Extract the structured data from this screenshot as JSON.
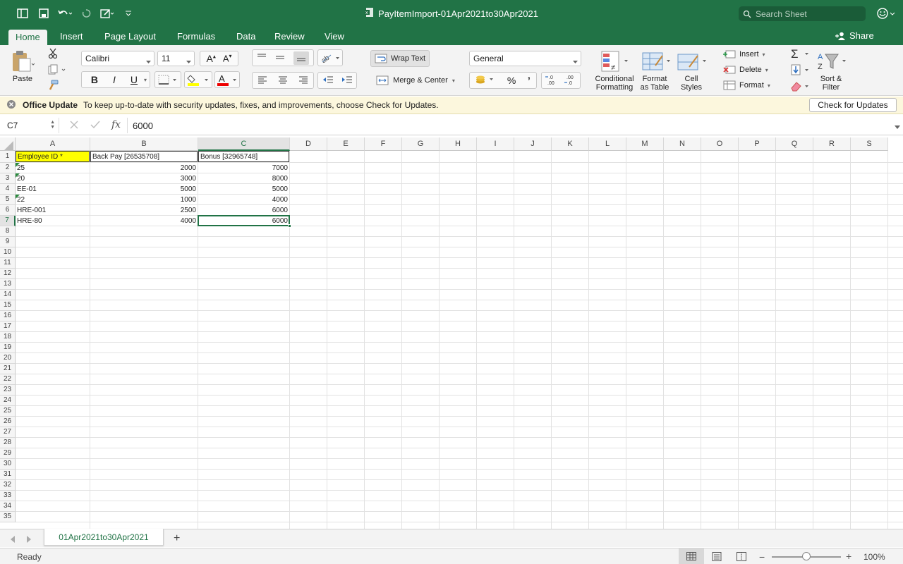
{
  "window": {
    "title": "PayItemImport-01Apr2021to30Apr2021"
  },
  "search": {
    "placeholder": "Search Sheet"
  },
  "ribbon_tabs": [
    "Home",
    "Insert",
    "Page Layout",
    "Formulas",
    "Data",
    "Review",
    "View"
  ],
  "share_label": "Share",
  "ribbon": {
    "paste": "Paste",
    "font_name": "Calibri",
    "font_size": "11",
    "bold": "B",
    "italic": "I",
    "underline": "U",
    "wrap_text": "Wrap Text",
    "merge_center": "Merge & Center",
    "number_format": "General",
    "percent": "%",
    "comma": "’",
    "conditional_formatting": [
      "Conditional",
      "Formatting"
    ],
    "format_as_table": [
      "Format",
      "as Table"
    ],
    "cell_styles": [
      "Cell",
      "Styles"
    ],
    "insert": "Insert",
    "delete": "Delete",
    "format": "Format",
    "sort_filter": [
      "Sort &",
      "Filter"
    ]
  },
  "notice": {
    "title": "Office Update",
    "message": "To keep up-to-date with security updates, fixes, and improvements, choose Check for Updates.",
    "button": "Check for Updates"
  },
  "formula_bar": {
    "name_box": "C7",
    "fx": "fx",
    "value": "6000"
  },
  "columns": [
    "A",
    "B",
    "C",
    "D",
    "E",
    "F",
    "G",
    "H",
    "I",
    "J",
    "K",
    "L",
    "M",
    "N",
    "O",
    "P",
    "Q",
    "R",
    "S"
  ],
  "row_count": 35,
  "cells": {
    "headers": [
      "Employee ID *",
      "Back Pay [26535708]",
      "Bonus [32965748]"
    ],
    "rows": [
      [
        "25",
        "2000",
        "7000"
      ],
      [
        "20",
        "3000",
        "8000"
      ],
      [
        "EE-01",
        "5000",
        "5000"
      ],
      [
        "22",
        "1000",
        "4000"
      ],
      [
        "HRE-001",
        "2500",
        "6000"
      ],
      [
        "HRE-80",
        "4000",
        "6000"
      ]
    ]
  },
  "active_cell": "C7",
  "sheet_tab": "01Apr2021to30Apr2021",
  "status": {
    "ready": "Ready",
    "zoom": "100%"
  },
  "colors": {
    "excel_green": "#217346",
    "header_fill": "#ffff00",
    "notice_bg": "#fcf7dd"
  }
}
